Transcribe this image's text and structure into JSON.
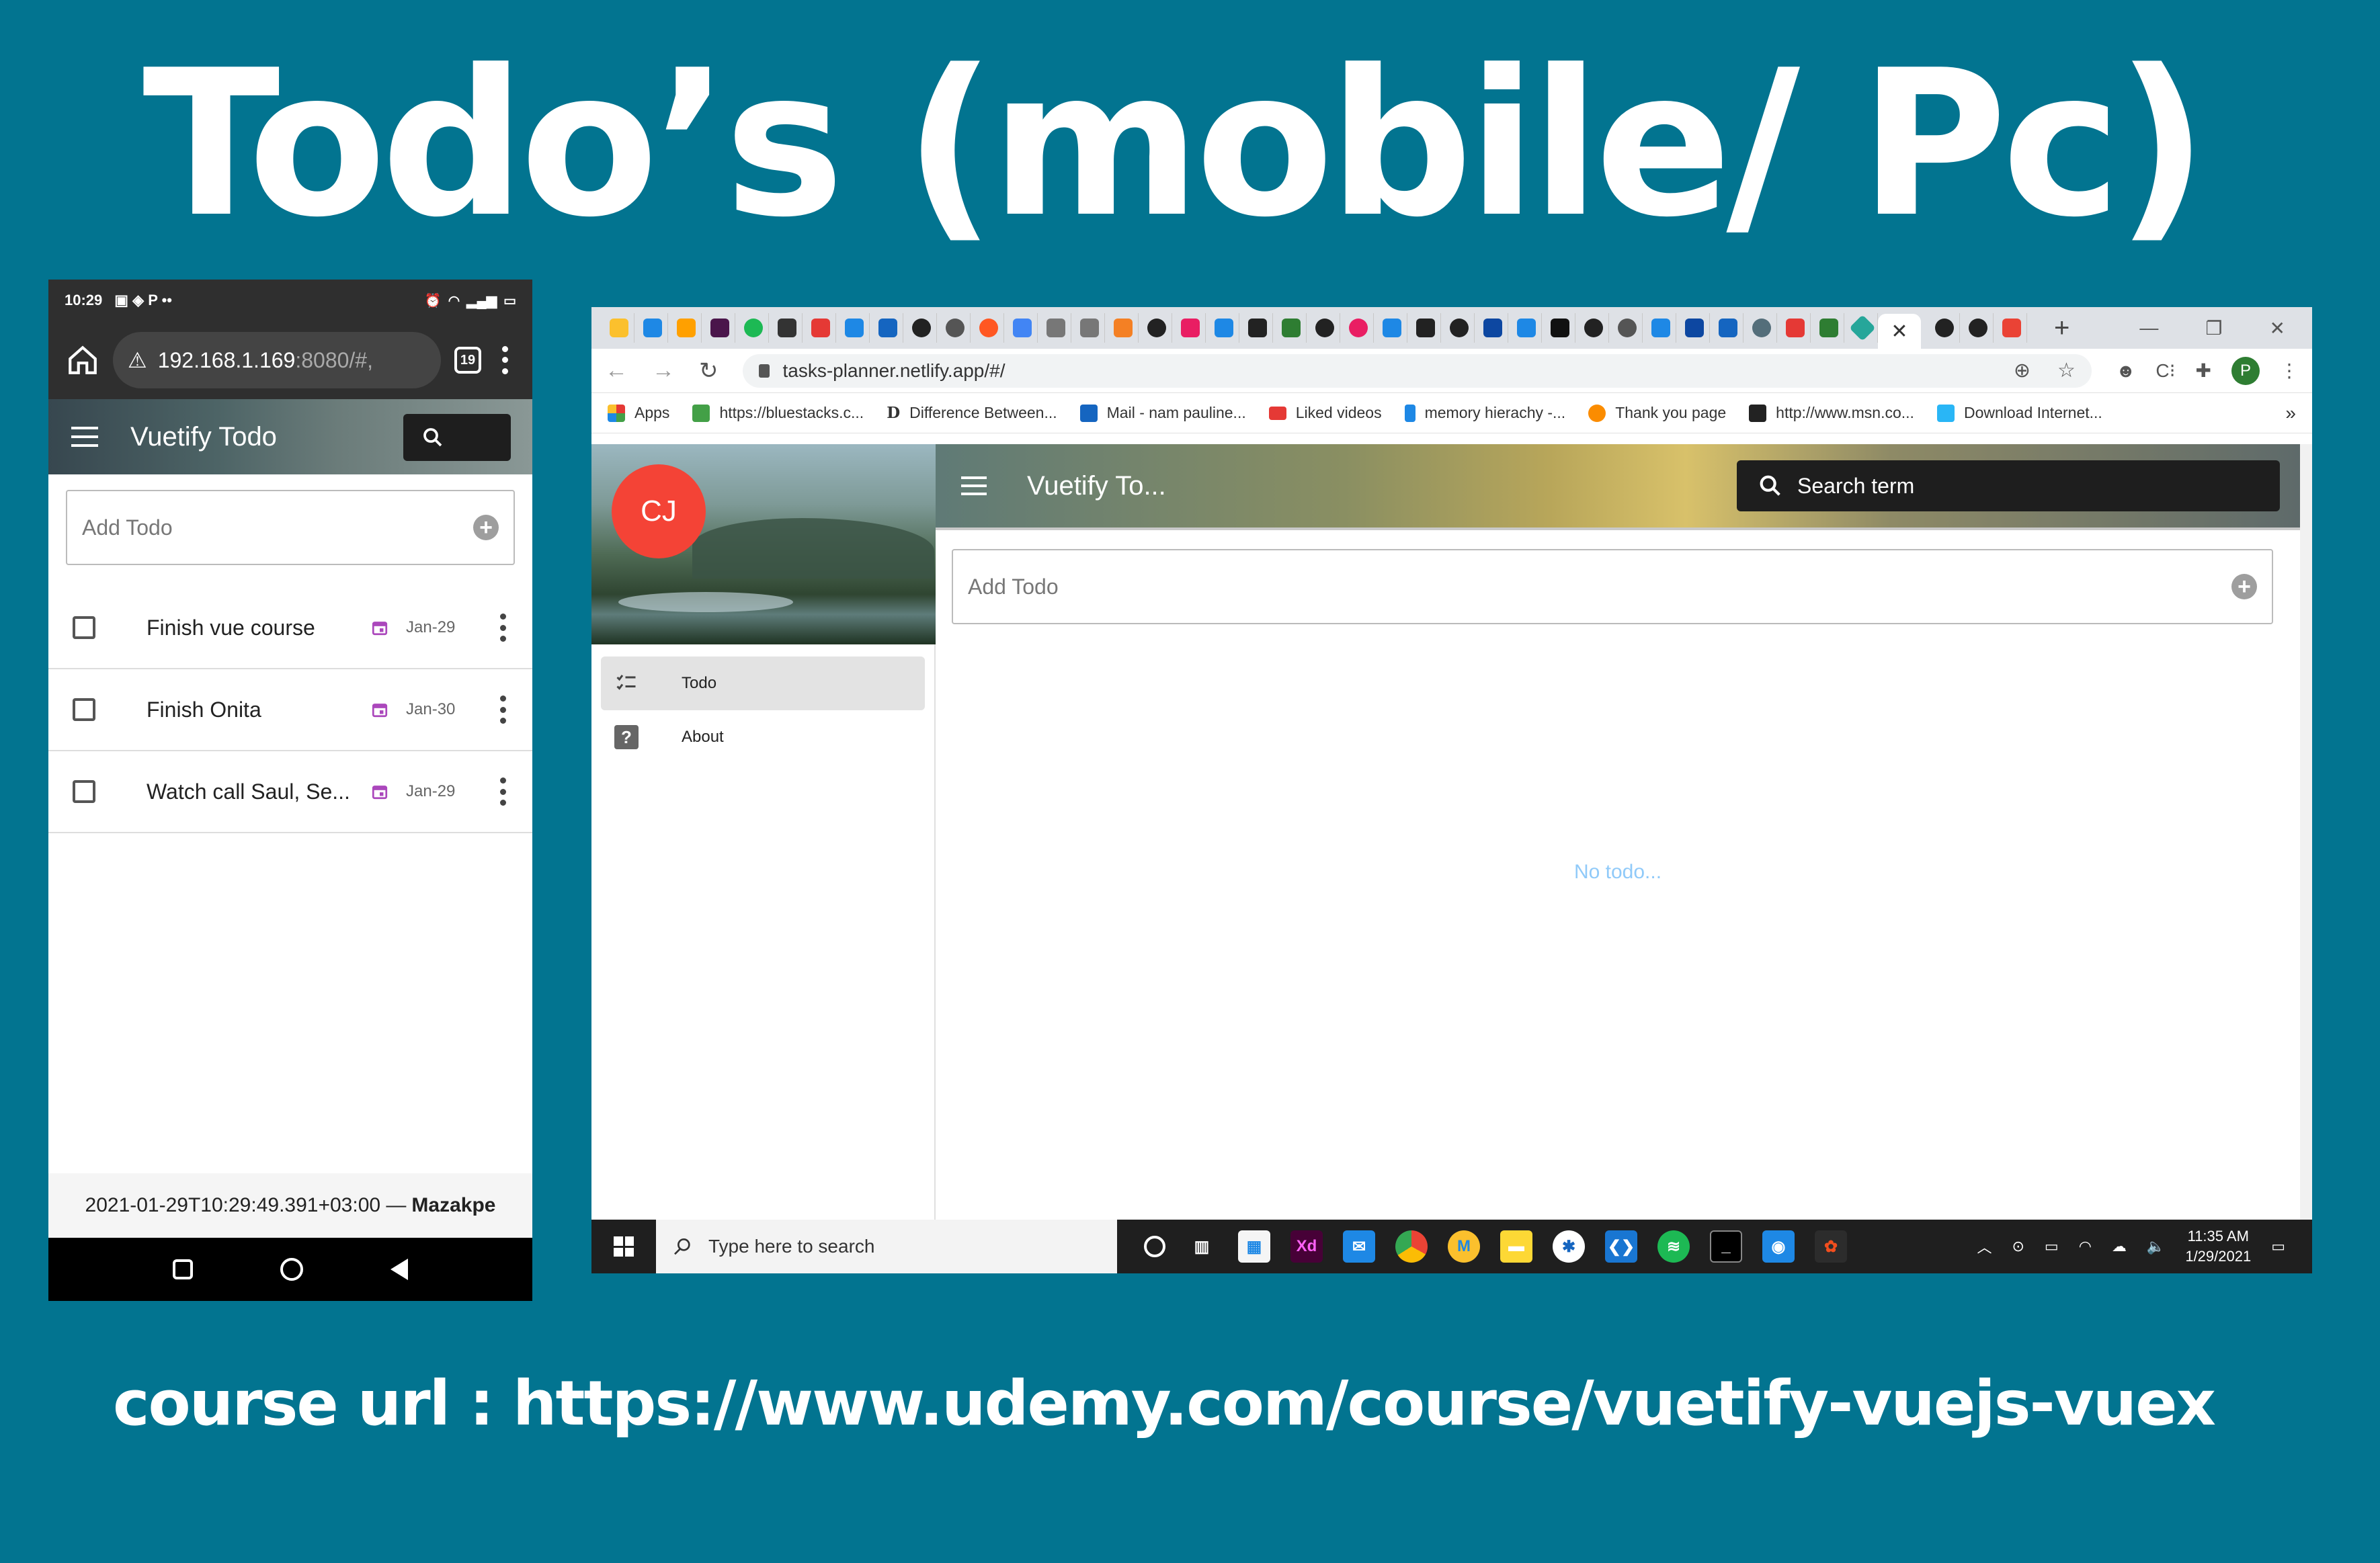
{
  "slide": {
    "title": "Todo’s (mobile/ Pc)",
    "course_url": "course url : https://www.udemy.com/course/vuetify-vuejs-vuex"
  },
  "mobile": {
    "status_time": "10:29",
    "url_host": "192.168.1.169",
    "url_rest": ":8080/#,",
    "tab_count": "19",
    "app_title": "Vuetify Todo",
    "add_placeholder": "Add Todo",
    "todos": [
      {
        "title": "Finish vue course",
        "date": "Jan-29"
      },
      {
        "title": "Finish Onita",
        "date": "Jan-30"
      },
      {
        "title": "Watch call Saul, Se...",
        "date": "Jan-29"
      }
    ],
    "footer_timestamp": "2021-01-29T10:29:49.391+03:00 —",
    "footer_author": "Mazakpe"
  },
  "desktop": {
    "url": "tasks-planner.netlify.app/#/",
    "bookmarks": [
      {
        "label": "Apps",
        "color": "#e53935"
      },
      {
        "label": "https://bluestacks.c...",
        "color": "#43a047"
      },
      {
        "label": "Difference Between...",
        "color": "#222222"
      },
      {
        "label": "Mail - nam pauline...",
        "color": "#1565c0"
      },
      {
        "label": "Liked videos",
        "color": "#e53935"
      },
      {
        "label": "memory hierachy -...",
        "color": "#1e88e5"
      },
      {
        "label": "Thank you page",
        "color": "#fb8c00"
      },
      {
        "label": "http://www.msn.co...",
        "color": "#222222"
      },
      {
        "label": "Download Internet...",
        "color": "#29b6f6"
      }
    ],
    "profile_initial": "P",
    "avatar_initials": "CJ",
    "nav": [
      {
        "label": "Todo"
      },
      {
        "label": "About"
      }
    ],
    "app_title": "Vuetify To...",
    "search_placeholder": "Search term",
    "add_placeholder": "Add Todo",
    "empty_text": "No todo...",
    "taskbar_search": "Type here to search",
    "clock_time": "11:35 AM",
    "clock_date": "1/29/2021"
  }
}
